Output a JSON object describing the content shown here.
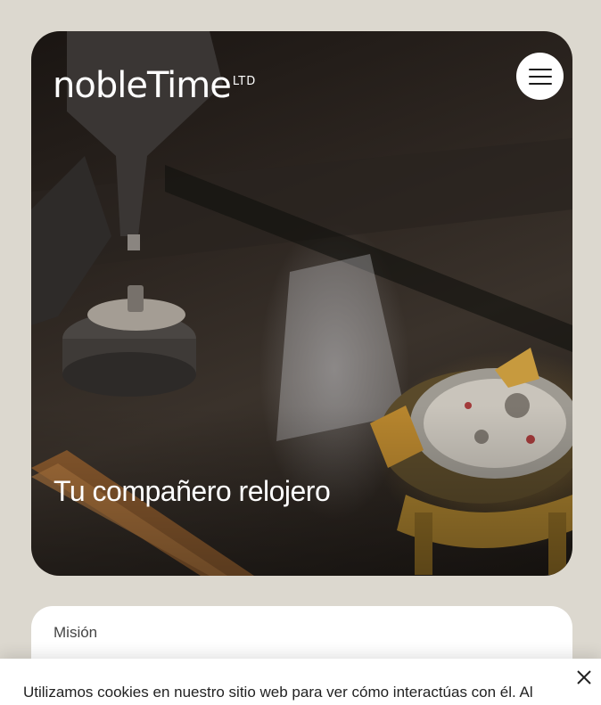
{
  "brand": {
    "logo_main": "nobleTime",
    "logo_sub": "LTD"
  },
  "header": {
    "menu_icon": "hamburger-icon"
  },
  "hero": {
    "title": "Tu compañero relojero",
    "image_subject": "watchmaker workbench with watch movement"
  },
  "mission": {
    "label": "Misión"
  },
  "cookie_banner": {
    "text": "Utilizamos cookies en nuestro sitio web para ver cómo interactúas con él. Al",
    "close_icon": "close-icon"
  },
  "colors": {
    "page_background": "#dcd8cf",
    "text_light": "#ffffff",
    "text_dark": "#222222"
  }
}
